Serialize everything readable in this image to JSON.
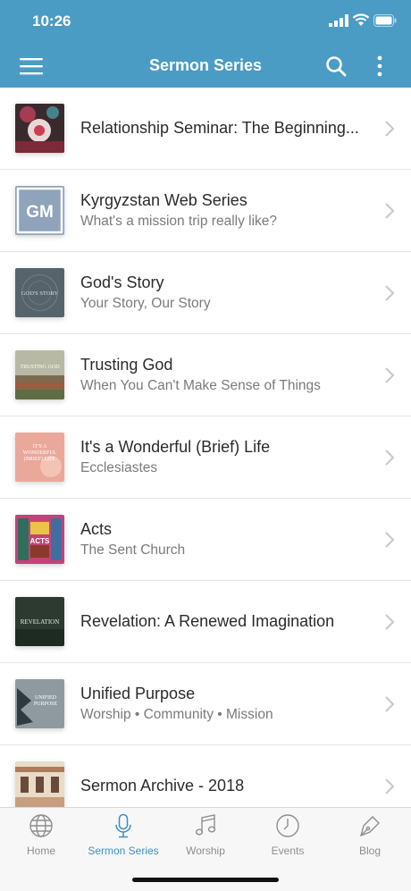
{
  "status_bar": {
    "time": "10:26"
  },
  "header": {
    "title": "Sermon Series"
  },
  "series": [
    {
      "title": "Relationship Seminar: The Beginning...",
      "subtitle": "",
      "thumb": "relationship"
    },
    {
      "title": "Kyrgyzstan Web Series",
      "subtitle": "What's a mission trip really like?",
      "thumb": "gm",
      "thumb_text": "GM"
    },
    {
      "title": "God's Story",
      "subtitle": "Your Story, Our Story",
      "thumb": "gods-story",
      "thumb_text": "GOD'S STORY"
    },
    {
      "title": "Trusting God",
      "subtitle": "When You Can't Make Sense of Things",
      "thumb": "trusting-god",
      "thumb_text": "TRUSTING GOD"
    },
    {
      "title": "It's a Wonderful (Brief) Life",
      "subtitle": "Ecclesiastes",
      "thumb": "wonderful",
      "thumb_text": "IT'S A WONDERFUL (BRIEF) LIFE"
    },
    {
      "title": "Acts",
      "subtitle": "The Sent Church",
      "thumb": "acts",
      "thumb_text": "ACTS"
    },
    {
      "title": "Revelation: A Renewed Imagination",
      "subtitle": "",
      "thumb": "revelation",
      "thumb_text": "REVELATION"
    },
    {
      "title": "Unified Purpose",
      "subtitle": "Worship • Community • Mission",
      "thumb": "unified",
      "thumb_text": "UNIFIED PURPOSE"
    },
    {
      "title": "Sermon Archive - 2018",
      "subtitle": "",
      "thumb": "archive"
    }
  ],
  "tabs": [
    {
      "label": "Home",
      "icon": "globe-icon",
      "active": false
    },
    {
      "label": "Sermon Series",
      "icon": "microphone-icon",
      "active": true
    },
    {
      "label": "Worship",
      "icon": "music-note-icon",
      "active": false
    },
    {
      "label": "Events",
      "icon": "clock-icon",
      "active": false
    },
    {
      "label": "Blog",
      "icon": "pen-icon",
      "active": false
    }
  ],
  "colors": {
    "header": "#4a9cc4",
    "active_tab": "#3d8fbf",
    "inactive_tab": "#8e8e8e"
  }
}
